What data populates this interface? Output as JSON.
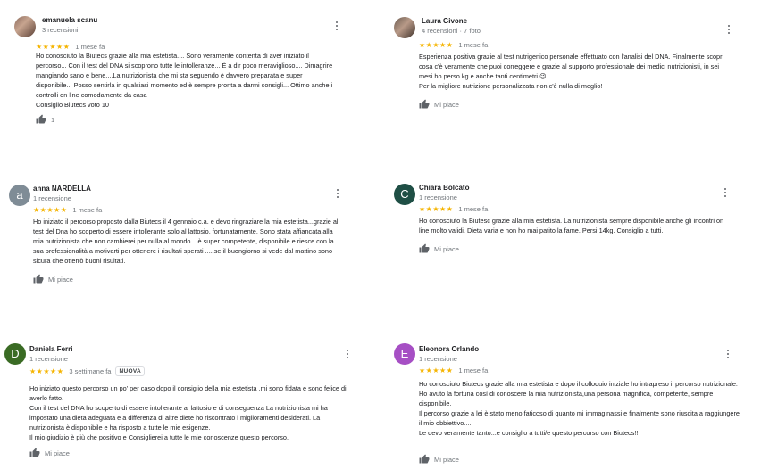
{
  "colors": {
    "star": "#f5b400",
    "avatar_anna": "#7f8c96",
    "avatar_chiara": "#1f4f45",
    "avatar_daniela": "#3a6b24",
    "avatar_eleonora": "#a64fc4"
  },
  "icons": {
    "like": "thumb-up-icon",
    "menu": "more-vert-icon",
    "stars": "star-icon"
  },
  "reviews": [
    {
      "name": "emanuela scanu",
      "meta": "3 recensioni",
      "stars": "★★★★★",
      "date": "1 mese fa",
      "paragraphs": [
        "Ho conosciuto la Biutecs grazie alla mia estetista.... Sono veramente contenta di aver iniziato il percorso... Con il test del DNA si scoprono tutte le intolleranze... È a dir poco meraviglioso.... Dimagrire mangiando sano e bene....La nutrizionista che mi sta seguendo è davvero preparata e super disponibile... Posso sentirla in qualsiasi momento ed è sempre pronta a darmi consigli... Ottimo anche i controlli on line comodamente da casa",
        "Consiglio Biutecs voto 10"
      ],
      "like": "1"
    },
    {
      "name": "Laura Givone",
      "meta": "4 recensioni · 7 foto",
      "stars": "★★★★★",
      "date": "1 mese fa",
      "paragraphs": [
        "Esperienza positiva grazie al test nutrigenico personale effettuato con l'analisi del DNA. Finalmente scopri cosa c'è veramente che puoi correggere e grazie al supporto professionale dei medici nutrizionisti, in sei mesi ho perso kg e anche tanti centimetri 😉",
        "Per la migliore nutrizione personalizzata non c'è nulla di meglio!"
      ],
      "like": "Mi piace"
    },
    {
      "name": "anna NARDELLA",
      "initial": "a",
      "meta": "1 recensione",
      "stars": "★★★★★",
      "date": "1 mese fa",
      "paragraphs": [
        "Ho iniziato il percorso proposto dalla Biutecs il 4 gennaio c.a. e devo ringraziare la mia estetista...grazie al test del Dna ho scoperto di essere intollerante solo al lattosio, fortunatamente. Sono stata affiancata alla mia nutrizionista che non cambierei per nulla al mondo....è super competente, disponibile e riesce con la sua professionalità a motivarti per ottenere i risultati sperati .....se il buongiorno si vede dal mattino sono sicura che otterrò buoni risultati."
      ],
      "like": "Mi piace"
    },
    {
      "name": "Chiara Bolcato",
      "initial": "C",
      "meta": "1 recensione",
      "stars": "★★★★★",
      "date": "1 mese fa",
      "paragraphs": [
        "Ho conosciuto la Biutesc grazie alla mia estetista. La nutrizionista sempre disponibile anche gli incontri on line molto validi. Dieta varia e non ho mai patito la fame. Persi 14kg. Consiglio a tutti."
      ],
      "like": "Mi piace"
    },
    {
      "name": "Daniela Ferri",
      "initial": "D",
      "meta": "1 recensione",
      "stars": "★★★★★",
      "date": "3 settimane fa",
      "badge": "NUOVA",
      "paragraphs": [
        "Ho iniziato questo percorso un po' per caso dopo il consiglio della mia estetista ,mi sono fidata e sono felice di averlo fatto.",
        "Con il  test del DNA ho scoperto di essere intollerante al lattosio e di conseguenza   La nutrizionista mi ha impostato una dieta adeguata e a differenza di altre diete ho riscontrato i miglioramenti desiderati. La nutrizionista è disponibile e ha risposto a tutte le mie esigenze.",
        "Il mio giudizio è più che positivo e Consiglierei a tutte le mie conoscenze questo percorso."
      ],
      "like": "Mi piace"
    },
    {
      "name": "Eleonora Orlando",
      "initial": "E",
      "meta": "1 recensione",
      "stars": "★★★★★",
      "date": "1 mese fa",
      "paragraphs": [
        "Ho conosciuto Biutecs  grazie alla mia estetista e dopo il colloquio iniziale ho intrapreso il percorso nutrizionale.",
        "Ho avuto la fortuna così di conoscere la mia nutrizionista,una persona magnifica, competente, sempre disponibile.",
        "Il percorso grazie a lei è stato meno faticoso di quanto mi immaginassi e finalmente sono riuscita a raggiungere il mio obbiettivo....",
        "Le devo veramente tanto...e consiglio a tutti/e questo percorso con Biutecs!!"
      ],
      "like": "Mi piace"
    }
  ]
}
